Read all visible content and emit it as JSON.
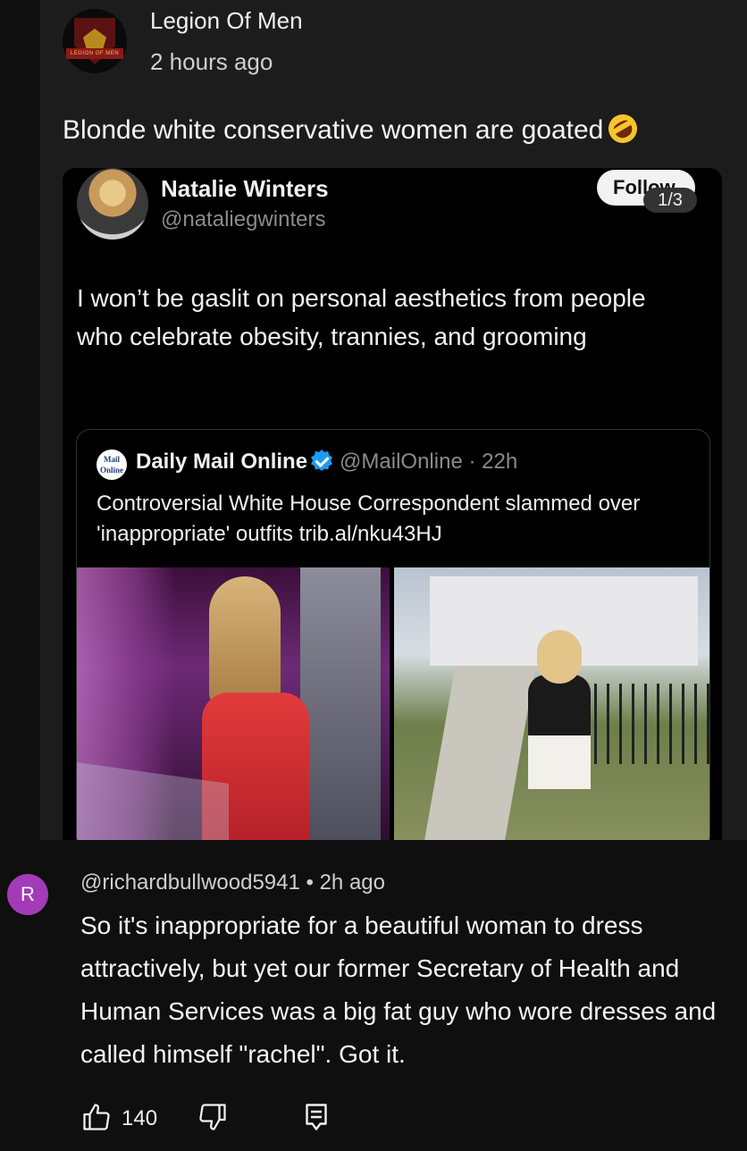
{
  "post": {
    "channel_name": "Legion Of Men",
    "time": "2 hours ago",
    "avatar_banner": "LEGION OF MEN",
    "text": "Blonde white conservative women are goated",
    "emoji": "rolling-on-floor-laughing-icon"
  },
  "tweet": {
    "name": "Natalie Winters",
    "handle": "@nataliegwinters",
    "follow_label": "Follow",
    "page_indicator": "1/3",
    "body": "I won’t be gaslit on personal aesthetics from people who celebrate obesity, trannies, and grooming",
    "quote": {
      "logo_text": "Mail Online",
      "name": "Daily Mail Online",
      "handle": "@MailOnline · 22h",
      "text": "Controversial White House Correspondent slammed over 'inappropriate' outfits trib.al/nku43HJ"
    }
  },
  "comment": {
    "avatar_letter": "R",
    "handle": "@richardbullwood5941 • 2h ago",
    "text": "So it's inappropriate for a beautiful woman to dress attractively, but yet our former Secretary of Health and Human Services was a big fat guy who wore dresses and called himself \"rachel\". Got it.",
    "like_count": "140"
  },
  "colors": {
    "background": "#0f0f0f",
    "panel": "#1c1c1c",
    "avatar_accent": "#a33bb8",
    "verified": "#1d9bf0"
  }
}
